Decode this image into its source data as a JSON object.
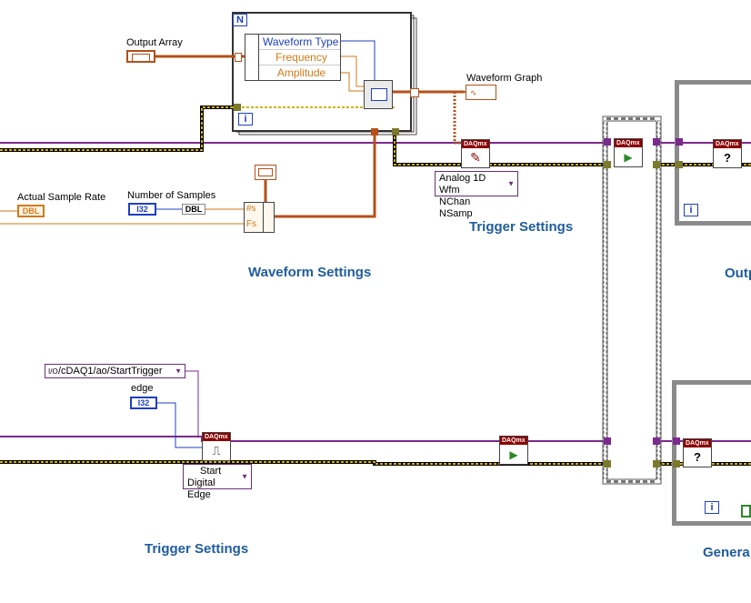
{
  "labels": {
    "output_array": "Output Array",
    "waveform_graph": "Waveform Graph",
    "actual_sample_rate": "Actual Sample Rate",
    "number_of_samples": "Number of Samples",
    "edge": "edge",
    "start_digital_edge": [
      "Start",
      "Digital Edge"
    ]
  },
  "comments": {
    "trigger_settings_top": "Trigger Settings",
    "waveform_settings": "Waveform Settings",
    "trigger_settings_bottom": "Trigger Settings",
    "output_cut": "Outp",
    "generation_cut": "Genera"
  },
  "for_loop": {
    "count_terminal": "N",
    "iteration_terminal": "i",
    "cluster": [
      "Waveform Type",
      "Frequency",
      "Amplitude"
    ]
  },
  "write_node": {
    "polymorphic": [
      "Analog 1D Wfm",
      "NChan NSamp"
    ]
  },
  "constants": {
    "trigger_source": "/cDAQ1/ao/StartTrigger",
    "trigger_source_prefix": "I/O"
  },
  "terminals": {
    "i32": "I32",
    "dbl": "DBL",
    "dbl_const": "DBL",
    "num_s": "#s",
    "fs": "Fs"
  },
  "icons": {
    "daq_header": "DAQmx",
    "right_frame_iter": "i",
    "bottom_right_iter": "i"
  },
  "colors": {
    "error_wire": "#d2b100",
    "task_wire": "#7a2a8c",
    "waveform_wire": "#b5501a",
    "numeric_wire": "#d27a1a",
    "int_wire": "#1f3fbf",
    "comment": "#1f5c9e",
    "daq_header": "#8b0000"
  }
}
